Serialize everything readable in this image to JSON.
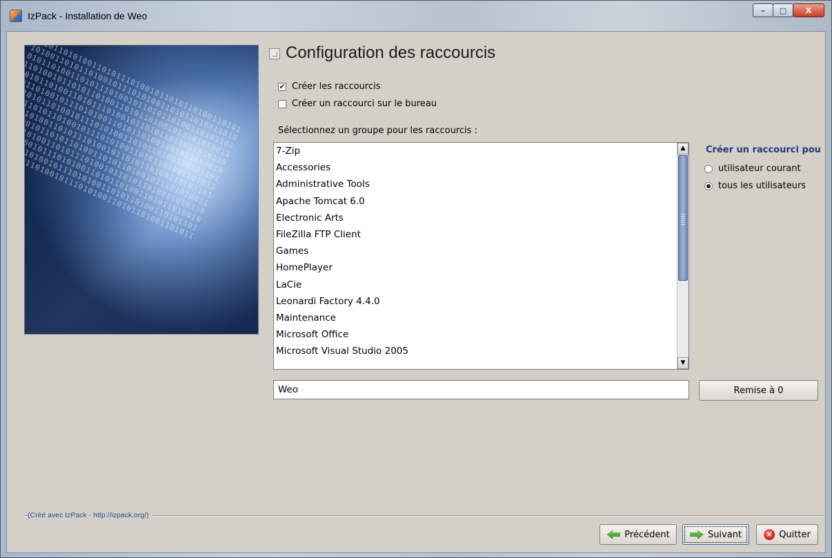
{
  "window": {
    "title": "IzPack - Installation de Weo",
    "controls": {
      "minimize": "–",
      "maximize": "□",
      "close": "X"
    }
  },
  "panel": {
    "title": "Configuration des raccourcis",
    "options": {
      "create_shortcuts": {
        "label": "Créer les raccourcis",
        "checked": true
      },
      "desktop_shortcut": {
        "label": "Créer un raccourci sur le bureau",
        "checked": false
      }
    },
    "group_list_label": "Sélectionnez un groupe pour les raccourcis :",
    "groups": [
      "7-Zip",
      "Accessories",
      "Administrative Tools",
      "Apache Tomcat 6.0",
      "Electronic Arts",
      "FileZilla FTP Client",
      "Games",
      "HomePlayer",
      "LaCie",
      "Leonardi Factory 4.4.0",
      "Maintenance",
      "Microsoft Office",
      "Microsoft Visual Studio 2005"
    ],
    "shortcut_target": {
      "title": "Créer un raccourci pou",
      "options": [
        {
          "label": "utilisateur courant",
          "selected": false
        },
        {
          "label": "tous les utilisateurs",
          "selected": true
        }
      ]
    },
    "group_name_value": "Weo",
    "reset_label": "Remise à 0"
  },
  "footer": {
    "credit": "(Créé avec IzPack - http://izpack.org/)",
    "prev_label": "Précédent",
    "next_label": "Suivant",
    "quit_label": "Quitter"
  },
  "icons": {
    "app": "izpack-installer-icon",
    "panel": "panel-header-icon",
    "prev": "green-left-arrow-icon",
    "next": "green-right-arrow-icon",
    "quit": "red-close-circle-icon"
  }
}
